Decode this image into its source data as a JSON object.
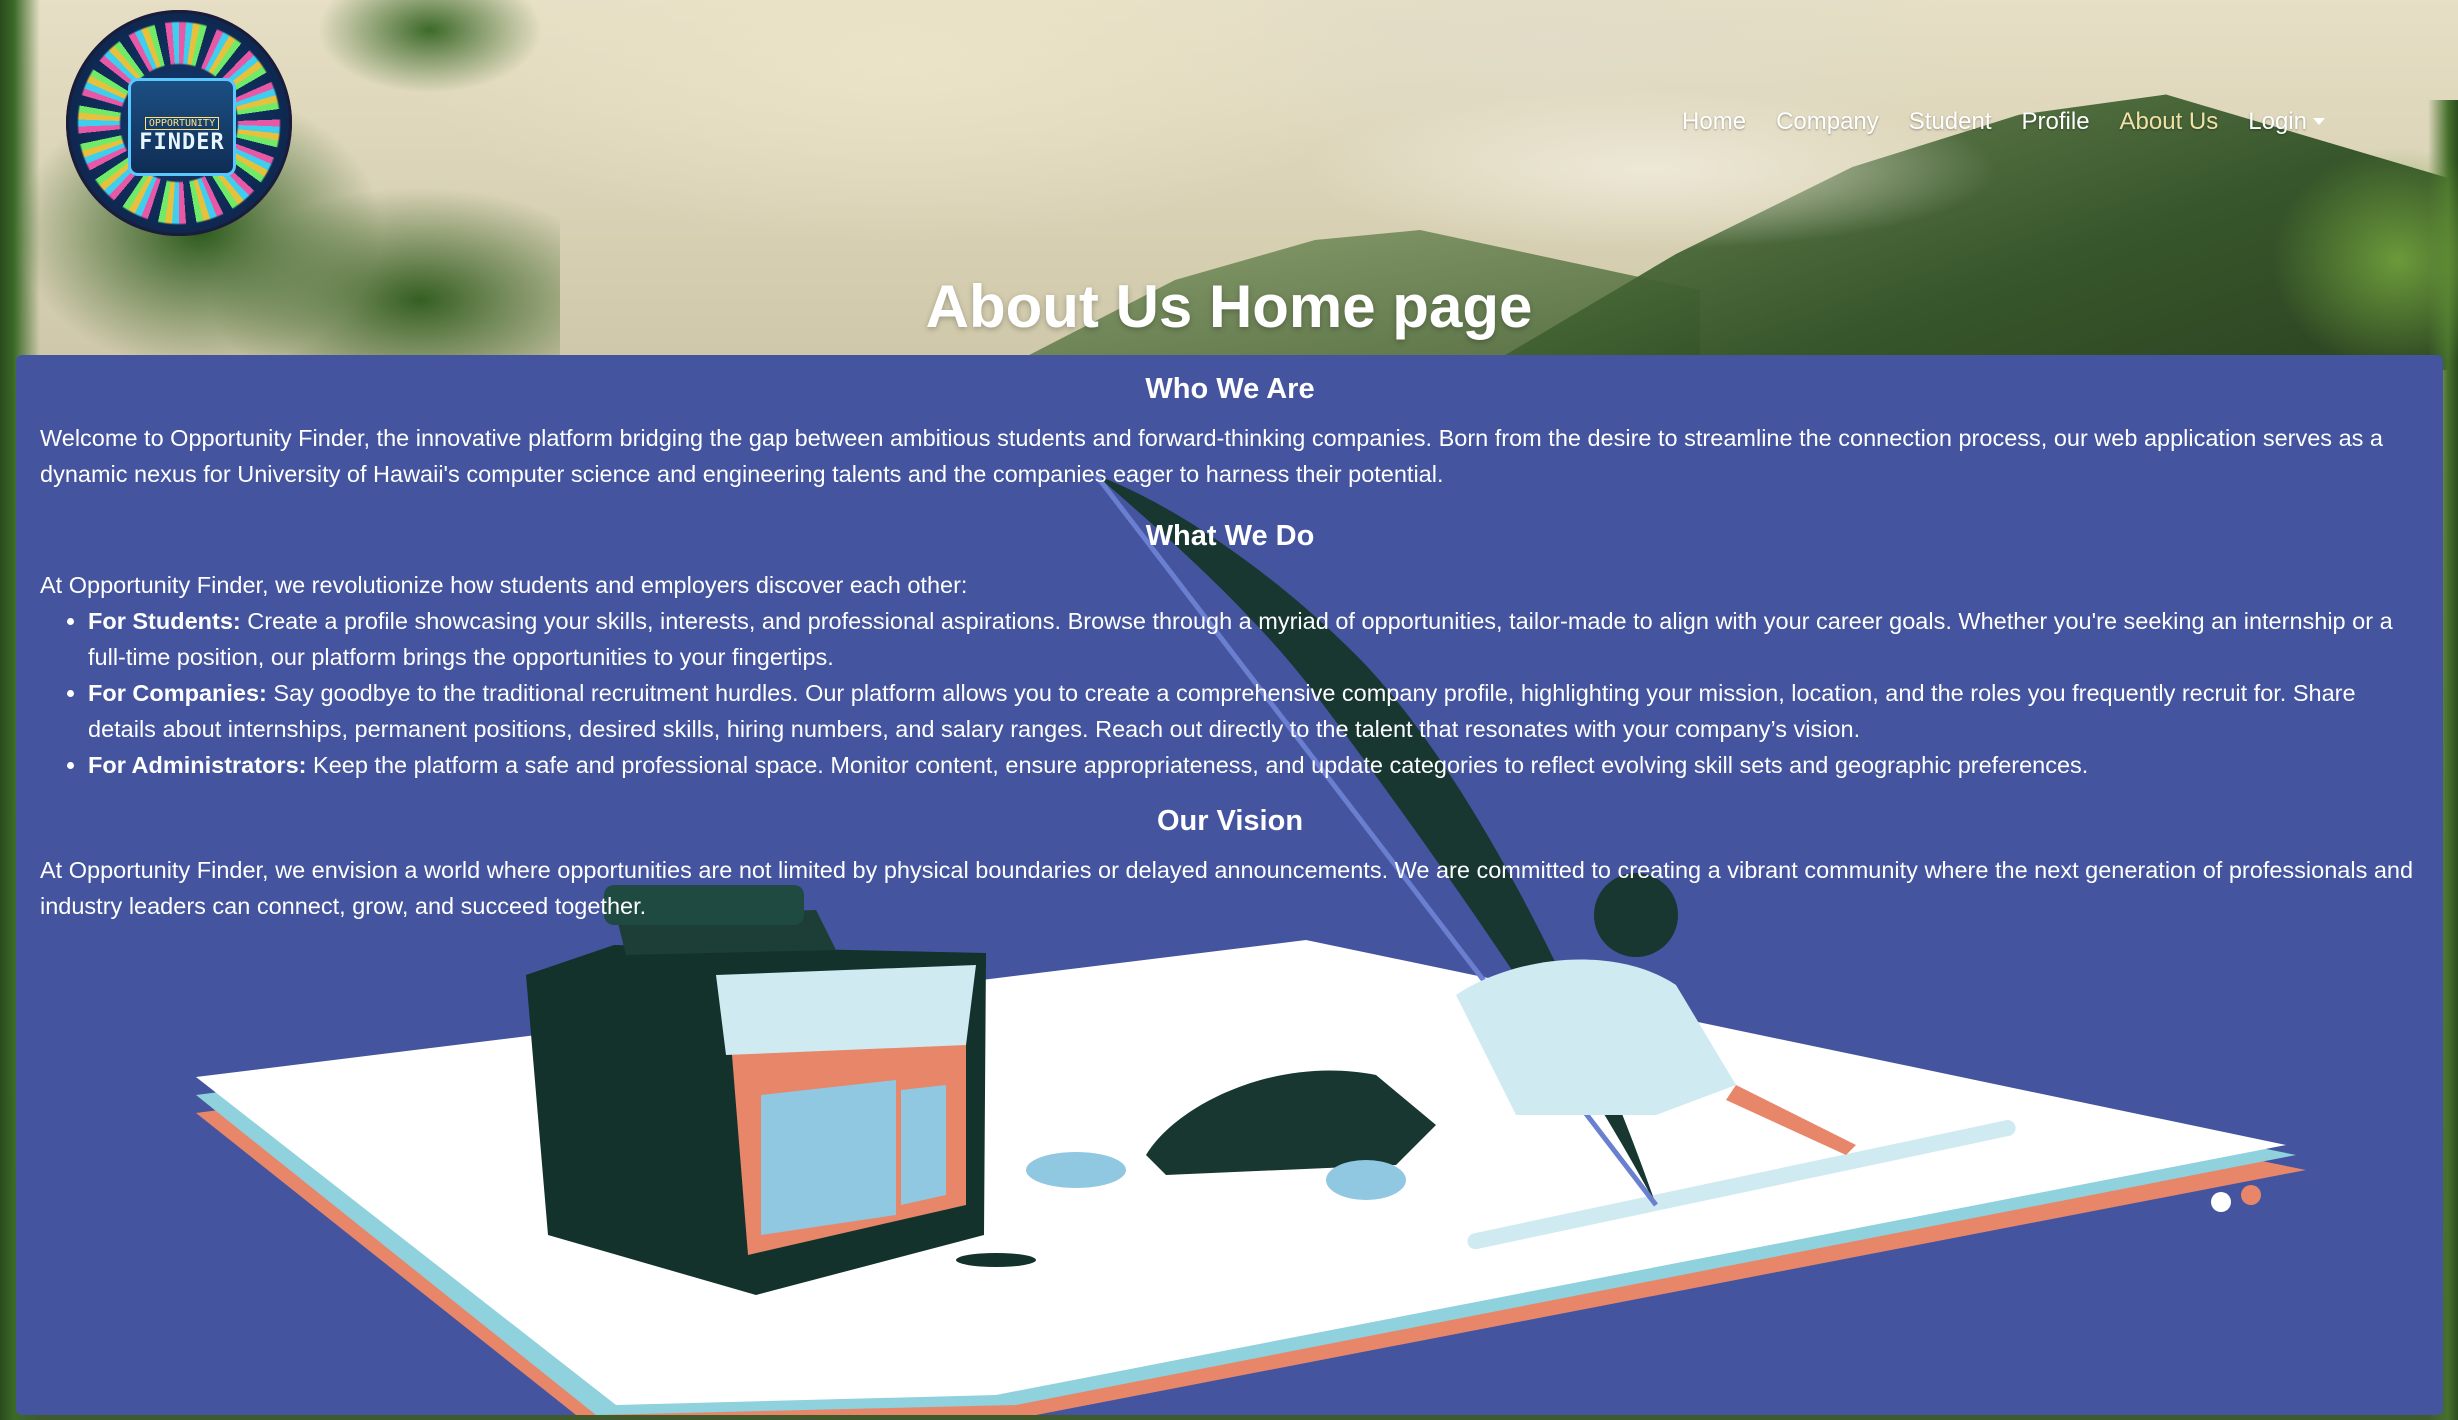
{
  "logo": {
    "line1": "OPPORTUNITY",
    "line2": "FINDER"
  },
  "nav": {
    "home": "Home",
    "company": "Company",
    "student": "Student",
    "profile": "Profile",
    "about": "About Us",
    "login": "Login"
  },
  "page_title": "About Us Home page",
  "sections": {
    "who": {
      "heading": "Who We Are",
      "text": "Welcome to Opportunity Finder, the innovative platform bridging the gap between ambitious students and forward-thinking companies. Born from the desire to streamline the connection process, our web application serves as a dynamic nexus for University of Hawaii's computer science and engineering talents and the companies eager to harness their potential."
    },
    "what": {
      "heading": "What We Do",
      "intro": "At Opportunity Finder, we revolutionize how students and employers discover each other:",
      "items": [
        {
          "label": "For Students:",
          "text": " Create a profile showcasing your skills, interests, and professional aspirations. Browse through a myriad of opportunities, tailor-made to align with your career goals. Whether you're seeking an internship or a full-time position, our platform brings the opportunities to your fingertips."
        },
        {
          "label": "For Companies:",
          "text": " Say goodbye to the traditional recruitment hurdles. Our platform allows you to create a comprehensive company profile, highlighting your mission, location, and the roles you frequently recruit for. Share details about internships, permanent positions, desired skills, hiring numbers, and salary ranges. Reach out directly to the talent that resonates with your company’s vision."
        },
        {
          "label": "For Administrators:",
          "text": " Keep the platform a safe and professional space. Monitor content, ensure appropriateness, and update categories to reflect evolving skill sets and geographic preferences."
        }
      ]
    },
    "vision": {
      "heading": "Our Vision",
      "text": "At Opportunity Finder, we envision a world where opportunities are not limited by physical boundaries or delayed announcements. We are committed to creating a vibrant community where the next generation of professionals and industry leaders can connect, grow, and succeed together."
    }
  },
  "colors": {
    "panel": "#44549f",
    "nav_active": "#f0e2a6",
    "accent_orange": "#e8866a"
  }
}
